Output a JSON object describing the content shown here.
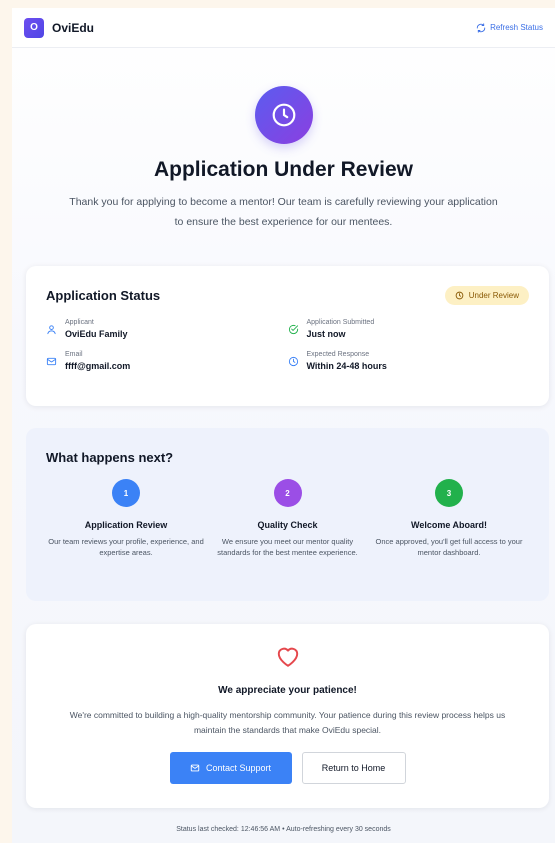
{
  "header": {
    "logo_letter": "O",
    "brand": "OviEdu",
    "refresh_label": "Refresh Status",
    "accent_color": "#3b6fe6"
  },
  "hero": {
    "icon": "clock-icon",
    "title": "Application Under Review",
    "subtitle": "Thank you for applying to become a mentor! Our team is carefully reviewing your application to ensure the best experience for our mentees."
  },
  "status": {
    "title": "Application Status",
    "badge": "Under Review",
    "items": [
      {
        "icon": "user-icon",
        "label": "Applicant",
        "value": "OviEdu Family"
      },
      {
        "icon": "check-circle-icon",
        "label": "Application Submitted",
        "value": "Just now"
      },
      {
        "icon": "mail-icon",
        "label": "Email",
        "value": "ffff@gmail.com"
      },
      {
        "icon": "clock-icon",
        "label": "Expected Response",
        "value": "Within 24-48 hours"
      }
    ]
  },
  "next": {
    "title": "What happens next?",
    "steps": [
      {
        "number": "1",
        "color": "#3b82f6",
        "title": "Application Review",
        "desc": "Our team reviews your profile, experience, and expertise areas."
      },
      {
        "number": "2",
        "color": "#9b4ee6",
        "title": "Quality Check",
        "desc": "We ensure you meet our mentor quality standards for the best mentee experience."
      },
      {
        "number": "3",
        "color": "#22b14c",
        "title": "Welcome Aboard!",
        "desc": "Once approved, you'll get full access to your mentor dashboard."
      }
    ]
  },
  "thanks": {
    "icon": "heart-icon",
    "title": "We appreciate your patience!",
    "text": "We're committed to building a high-quality mentorship community. Your patience during this review process helps us maintain the standards that make OviEdu special.",
    "contact_label": "Contact Support",
    "home_label": "Return to Home"
  },
  "footer": {
    "text": "Status last checked: 12:46:56 AM • Auto-refreshing every 30 seconds"
  }
}
